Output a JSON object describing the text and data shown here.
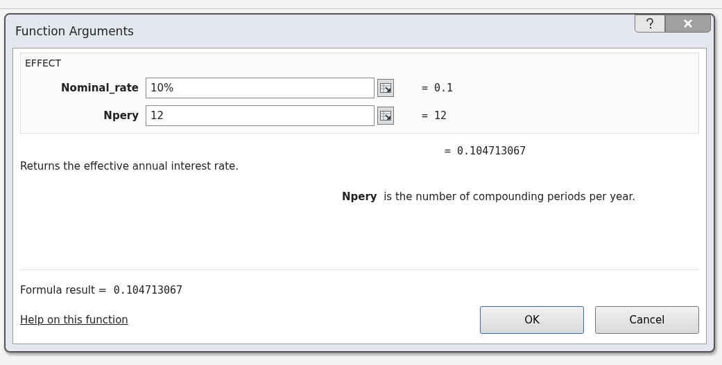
{
  "window": {
    "title": "Function Arguments"
  },
  "function_name": "EFFECT",
  "arguments": [
    {
      "name": "Nominal_rate",
      "value": "10%",
      "result": "= 0.1"
    },
    {
      "name": "Npery",
      "value": "12",
      "result": "= 12"
    }
  ],
  "overall_result": "= 0.104713067",
  "description": "Returns the effective annual interest rate.",
  "argument_help": {
    "name": "Npery",
    "text": "is the number of compounding periods per year."
  },
  "formula_result": {
    "label": "Formula result =",
    "value": "0.104713067"
  },
  "help_link": "Help on this function",
  "buttons": [
    {
      "label": "OK"
    },
    {
      "label": "Cancel"
    }
  ]
}
